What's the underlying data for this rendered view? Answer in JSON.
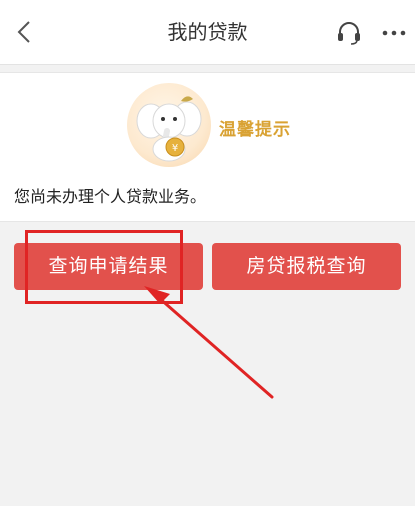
{
  "nav": {
    "title": "我的贷款",
    "back_icon": "chevron-left-icon",
    "support_icon": "headset-icon",
    "more_icon": "more-dots-icon"
  },
  "tip": {
    "title": "温馨提示",
    "message": "您尚未办理个人贷款业务。",
    "mascot": "elephant-mascot-icon"
  },
  "buttons": {
    "query_label": "查询申请结果",
    "tax_label": "房贷报税查询"
  },
  "colors": {
    "accent": "#e2514c",
    "tip_title": "#d9a233",
    "annotation": "#e02424"
  }
}
